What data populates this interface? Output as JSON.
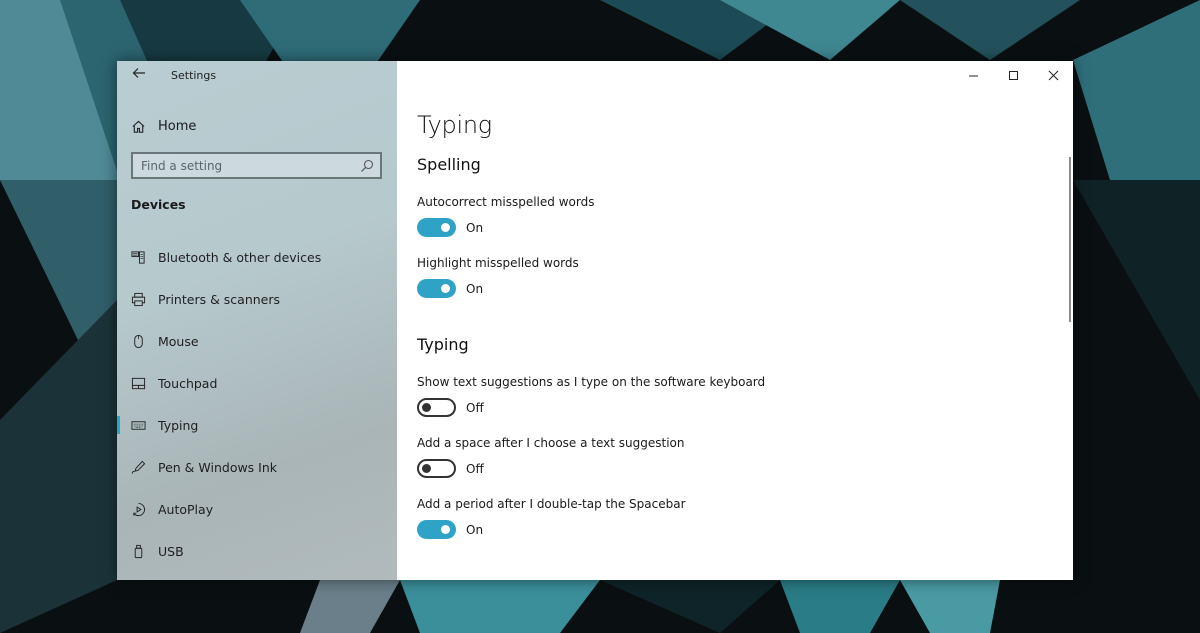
{
  "window": {
    "app_title": "Settings",
    "back_icon": "arrow-left-icon",
    "caption_buttons": [
      "minimize-icon",
      "maximize-icon",
      "close-icon"
    ]
  },
  "sidebar": {
    "home_label": "Home",
    "search_placeholder": "Find a setting",
    "search_value": "",
    "section_label": "Devices",
    "items": [
      {
        "label": "Bluetooth & other devices",
        "icon": "bluetooth-devices-icon",
        "active": false
      },
      {
        "label": "Printers & scanners",
        "icon": "printer-icon",
        "active": false
      },
      {
        "label": "Mouse",
        "icon": "mouse-icon",
        "active": false
      },
      {
        "label": "Touchpad",
        "icon": "touchpad-icon",
        "active": false
      },
      {
        "label": "Typing",
        "icon": "keyboard-icon",
        "active": true
      },
      {
        "label": "Pen & Windows Ink",
        "icon": "pen-icon",
        "active": false
      },
      {
        "label": "AutoPlay",
        "icon": "autoplay-icon",
        "active": false
      },
      {
        "label": "USB",
        "icon": "usb-icon",
        "active": false
      }
    ]
  },
  "main": {
    "page_title": "Typing",
    "groups": [
      {
        "title": "Spelling",
        "settings": [
          {
            "label": "Autocorrect misspelled words",
            "state": "On"
          },
          {
            "label": "Highlight misspelled words",
            "state": "On"
          }
        ]
      },
      {
        "title": "Typing",
        "settings": [
          {
            "label": "Show text suggestions as I type on the software keyboard",
            "state": "Off"
          },
          {
            "label": "Add a space after I choose a text suggestion",
            "state": "Off"
          },
          {
            "label": "Add a period after I double-tap the Spacebar",
            "state": "On"
          }
        ]
      }
    ]
  },
  "colors": {
    "accent": "#2ea3c6",
    "sidebar_bg": "#b6c9cd"
  }
}
